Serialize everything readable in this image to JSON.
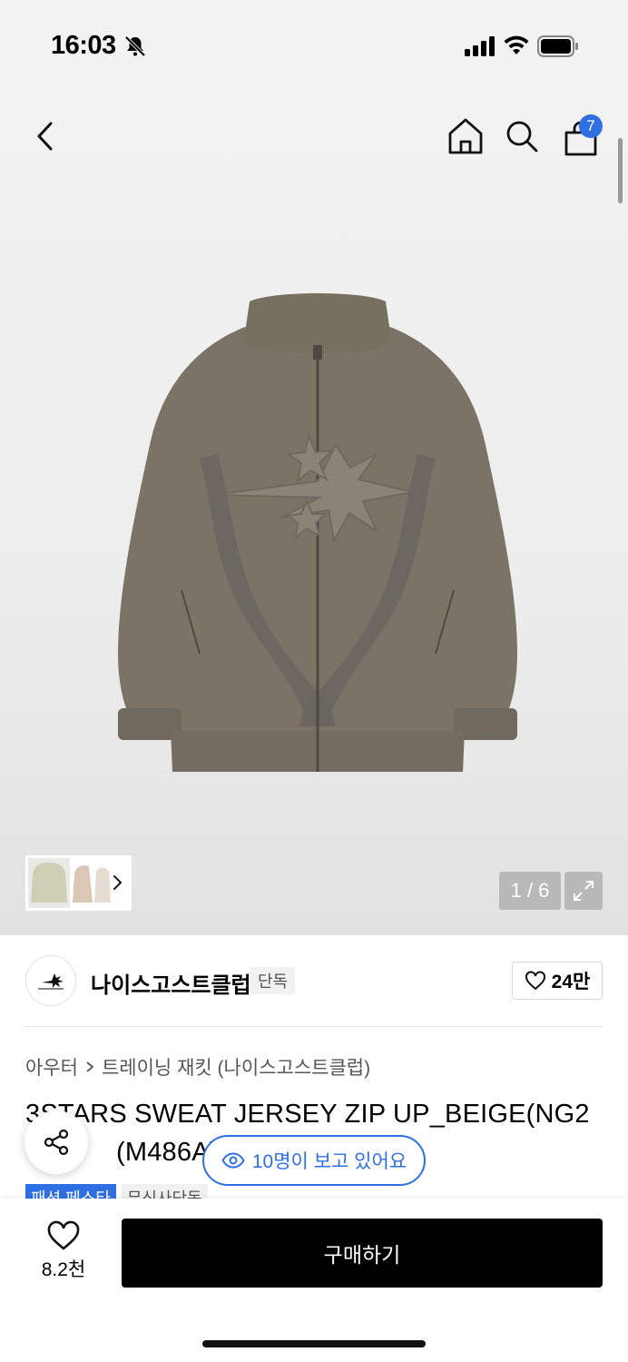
{
  "status_bar": {
    "time": "16:03",
    "icons": [
      "bell-muted-icon",
      "cellular-signal-icon",
      "wifi-icon",
      "battery-icon"
    ]
  },
  "nav": {
    "icons": [
      "back-icon",
      "home-icon",
      "search-icon",
      "shopping-bag-icon"
    ],
    "cart_count": "7"
  },
  "gallery": {
    "page_indicator": "1 / 6",
    "expand_icon": "expand-icon",
    "thumbnail_next_icon": "chevron-right-icon"
  },
  "brand": {
    "name": "나이스고스트클럽",
    "tag": "단독",
    "likes": "24만"
  },
  "breadcrumb": {
    "category": "아우터",
    "subcategory": "트레이닝 재킷 (나이스고스트클럽)"
  },
  "product": {
    "title": "3STARS SWEAT JERSEY ZIP UP_BEIGE(NG2 (M486A)",
    "title_line1": "3STARS SWEAT JERSEY ZIP UP_BEIGE(NG2",
    "title_line2": "(M486A)"
  },
  "viewers": {
    "text": "10명이 보고 있어요"
  },
  "tags": [
    "패션 페스타",
    "무신사단독"
  ],
  "bottom": {
    "wish_count": "8.2천",
    "buy_label": "구매하기"
  },
  "colors": {
    "accent": "#2f6fe4",
    "jacket": "#7b7466",
    "panel": "#6a665f",
    "cta": "#000000"
  }
}
